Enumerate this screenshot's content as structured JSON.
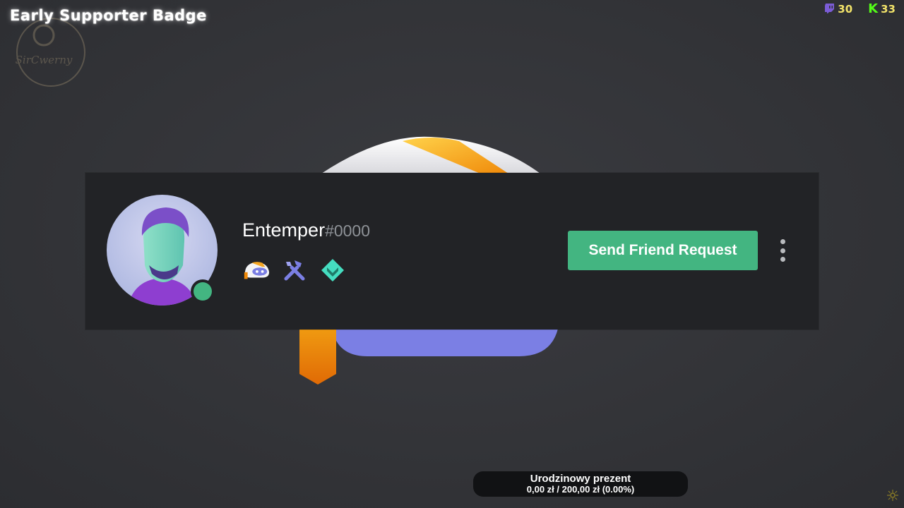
{
  "overlay": {
    "title": "Early Supporter Badge",
    "watermark_text": "SirCwerny",
    "twitch_count": "30",
    "kick_count": "33",
    "kick_letter": "K"
  },
  "profile": {
    "username": "Entemper",
    "discriminator": "#0000",
    "status": "online",
    "badges": [
      "early-supporter-badge",
      "hypesquad-events-badge",
      "hypesquad-balance-badge"
    ],
    "action_label": "Send Friend Request"
  },
  "donation": {
    "title": "Urodzinowy prezent",
    "progress_text": "0,00 zł  /  200,00 zł (0.00%)",
    "progress_fraction": 0.0
  },
  "colors": {
    "accent_green": "#43b581",
    "blurple": "#7b7fe4",
    "orange": "#f09a11",
    "card_bg": "#222326"
  }
}
